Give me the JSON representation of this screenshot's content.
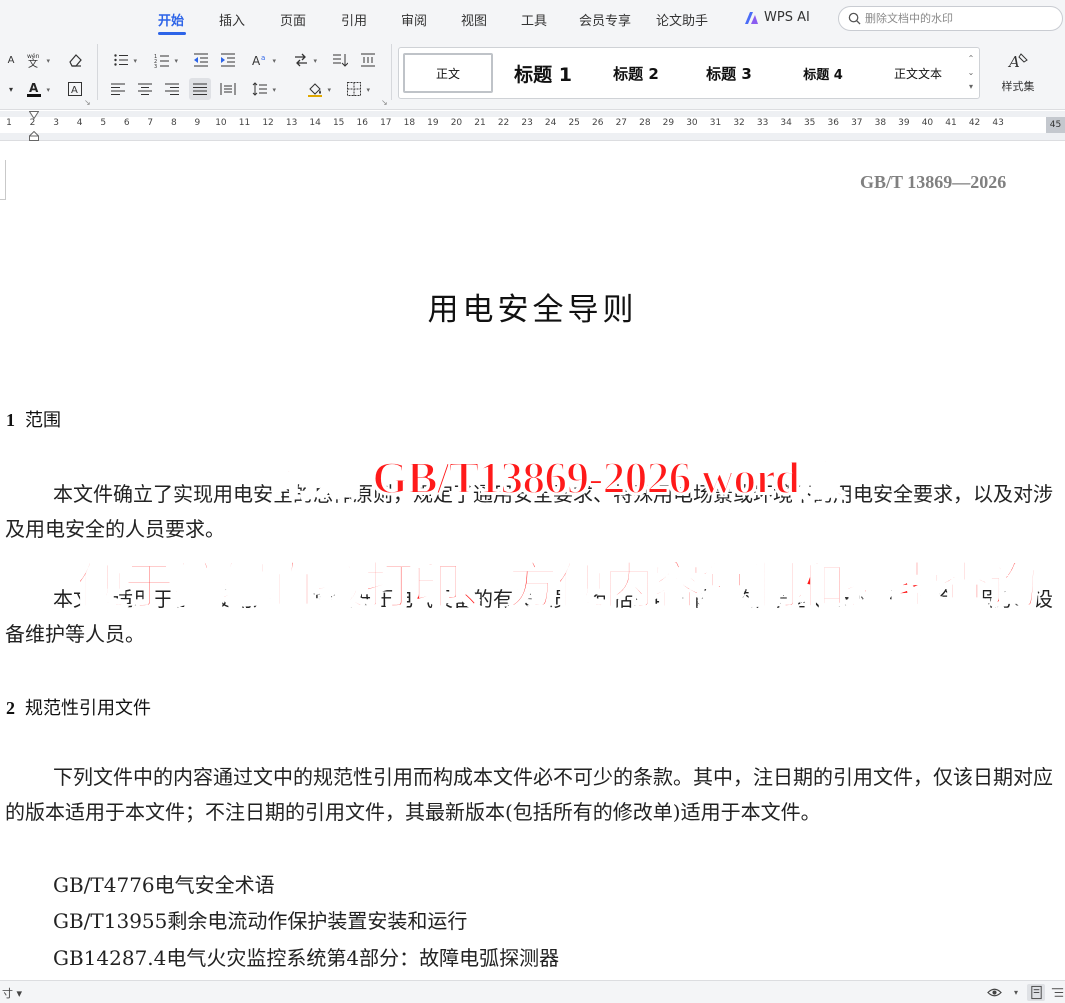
{
  "menu": {
    "tabs": [
      "开始",
      "插入",
      "页面",
      "引用",
      "审阅",
      "视图",
      "工具",
      "会员专享",
      "论文助手"
    ],
    "active_tab": "开始",
    "ai_label": "WPS AI",
    "search_placeholder": "删除文档中的水印"
  },
  "ribbon": {
    "styles": [
      "正文",
      "标题 1",
      "标题 2",
      "标题 3",
      "标题 4",
      "正文文本"
    ],
    "selected_style": "正文",
    "style_set_label": "样式集"
  },
  "ruler": {
    "ticks": [
      "1",
      "2",
      "3",
      "4",
      "5",
      "6",
      "7",
      "8",
      "9",
      "10",
      "11",
      "12",
      "13",
      "14",
      "15",
      "16",
      "17",
      "18",
      "19",
      "20",
      "21",
      "22",
      "23",
      "24",
      "25",
      "26",
      "27",
      "28",
      "29",
      "30",
      "31",
      "32",
      "33",
      "34",
      "35",
      "36",
      "37",
      "38",
      "39",
      "40",
      "41",
      "42",
      "43"
    ],
    "end_tick": "45"
  },
  "document": {
    "header": "GB/T 13869—2026",
    "title": "用电安全导则",
    "section_1": {
      "number": "1",
      "title": "范围"
    },
    "para_1": "本文件确立了实现用电安全的总体原则，规定了通用安全要求、特殊用电场景或环境下的用电安全要求，以及对涉及用电安全的人员要求。",
    "para_2": "本文件适用于各类使用及可能接触低压电气设备的有关人员，包括用电主体、监督管理、安装调试、检查服务、设备维护等人员。",
    "section_2": {
      "number": "2",
      "title": "规范性引用文件"
    },
    "para_3": "下列文件中的内容通过文中的规范性引用而构成本文件必不可少的条款。其中，注日期的引用文件，仅该日期对应的版本适用于本文件；不注日期的引用文件，其最新版本(包括所有的修改单)适用于本文件。",
    "references": [
      "GB/T4776电气安全术语",
      "GB/T13955剩余电流动作保护装置安装和运行",
      "GB14287.4电气火灾监控系统第4部分：故障电弧探测器"
    ]
  },
  "overlay": {
    "line_1": "附赠 GB/T13869-2026 word版",
    "line_2": "便于编辑直接打印、方便内容复制和搜索查询"
  },
  "status": {
    "left_text": "寸"
  },
  "colors": {
    "accent": "#2d64e8",
    "overlay_text": "#ff1a1a",
    "header_text": "#808080"
  }
}
